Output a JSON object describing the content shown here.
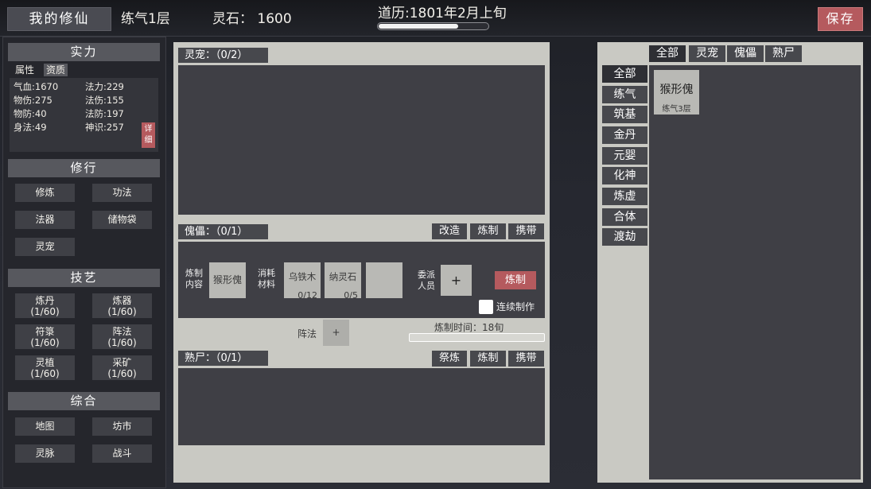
{
  "top": {
    "title": "我的修仙",
    "realm": "练气1层",
    "stones": "灵石： 1600",
    "calendar": "道历:1801年2月上旬",
    "progress": 0.73,
    "save": "保存"
  },
  "left": {
    "strength": {
      "title": "实力",
      "tabs": [
        "属性",
        "资质"
      ],
      "stats": [
        "气血:1670",
        "法力:229",
        "物伤:275",
        "法伤:155",
        "物防:40",
        "法防:197",
        "身法:49",
        "神识:257"
      ],
      "detail": [
        "详",
        "细"
      ]
    },
    "practice": {
      "title": "修行",
      "buttons": [
        "修炼",
        "功法",
        "法器",
        "储物袋",
        "灵宠"
      ]
    },
    "craft": {
      "title": "技艺",
      "buttons": [
        [
          "炼丹",
          "(1/60)"
        ],
        [
          "炼器",
          "(1/60)"
        ],
        [
          "符箓",
          "(1/60)"
        ],
        [
          "阵法",
          "(1/60)"
        ],
        [
          "灵植",
          "(1/60)"
        ],
        [
          "采矿",
          "(1/60)"
        ]
      ]
    },
    "misc": {
      "title": "综合",
      "buttons": [
        "地图",
        "坊市",
        "灵脉",
        "战斗"
      ]
    }
  },
  "center": {
    "pets": {
      "label": "灵宠：（0/2）"
    },
    "puppets": {
      "label": "傀儡：（0/1）",
      "actions": [
        "改造",
        "炼制",
        "携带"
      ],
      "craft_content": [
        "炼制",
        "内容"
      ],
      "craft_item": "猴形傀",
      "cost_label": [
        "消耗",
        "材料"
      ],
      "materials": [
        {
          "name": "乌铁木",
          "count": "0/12"
        },
        {
          "name": "纳灵石",
          "count": "0/5"
        }
      ],
      "assign_label": [
        "委派",
        "人员"
      ],
      "plus": "+",
      "craft_button": "炼制",
      "continuous": "连续制作",
      "array_label": "阵法",
      "array_plus": "+",
      "craft_time": "炼制时间：18旬"
    },
    "corpses": {
      "label": "熟尸：（0/1）",
      "actions": [
        "祭炼",
        "炼制",
        "携带"
      ]
    }
  },
  "right": {
    "tabs": [
      "全部",
      "灵宠",
      "傀儡",
      "熟尸"
    ],
    "realms": [
      "全部",
      "练气",
      "筑基",
      "金丹",
      "元婴",
      "化神",
      "炼虚",
      "合体",
      "渡劫"
    ],
    "item": {
      "name": "猴形傀",
      "realm": "练气3层"
    }
  }
}
